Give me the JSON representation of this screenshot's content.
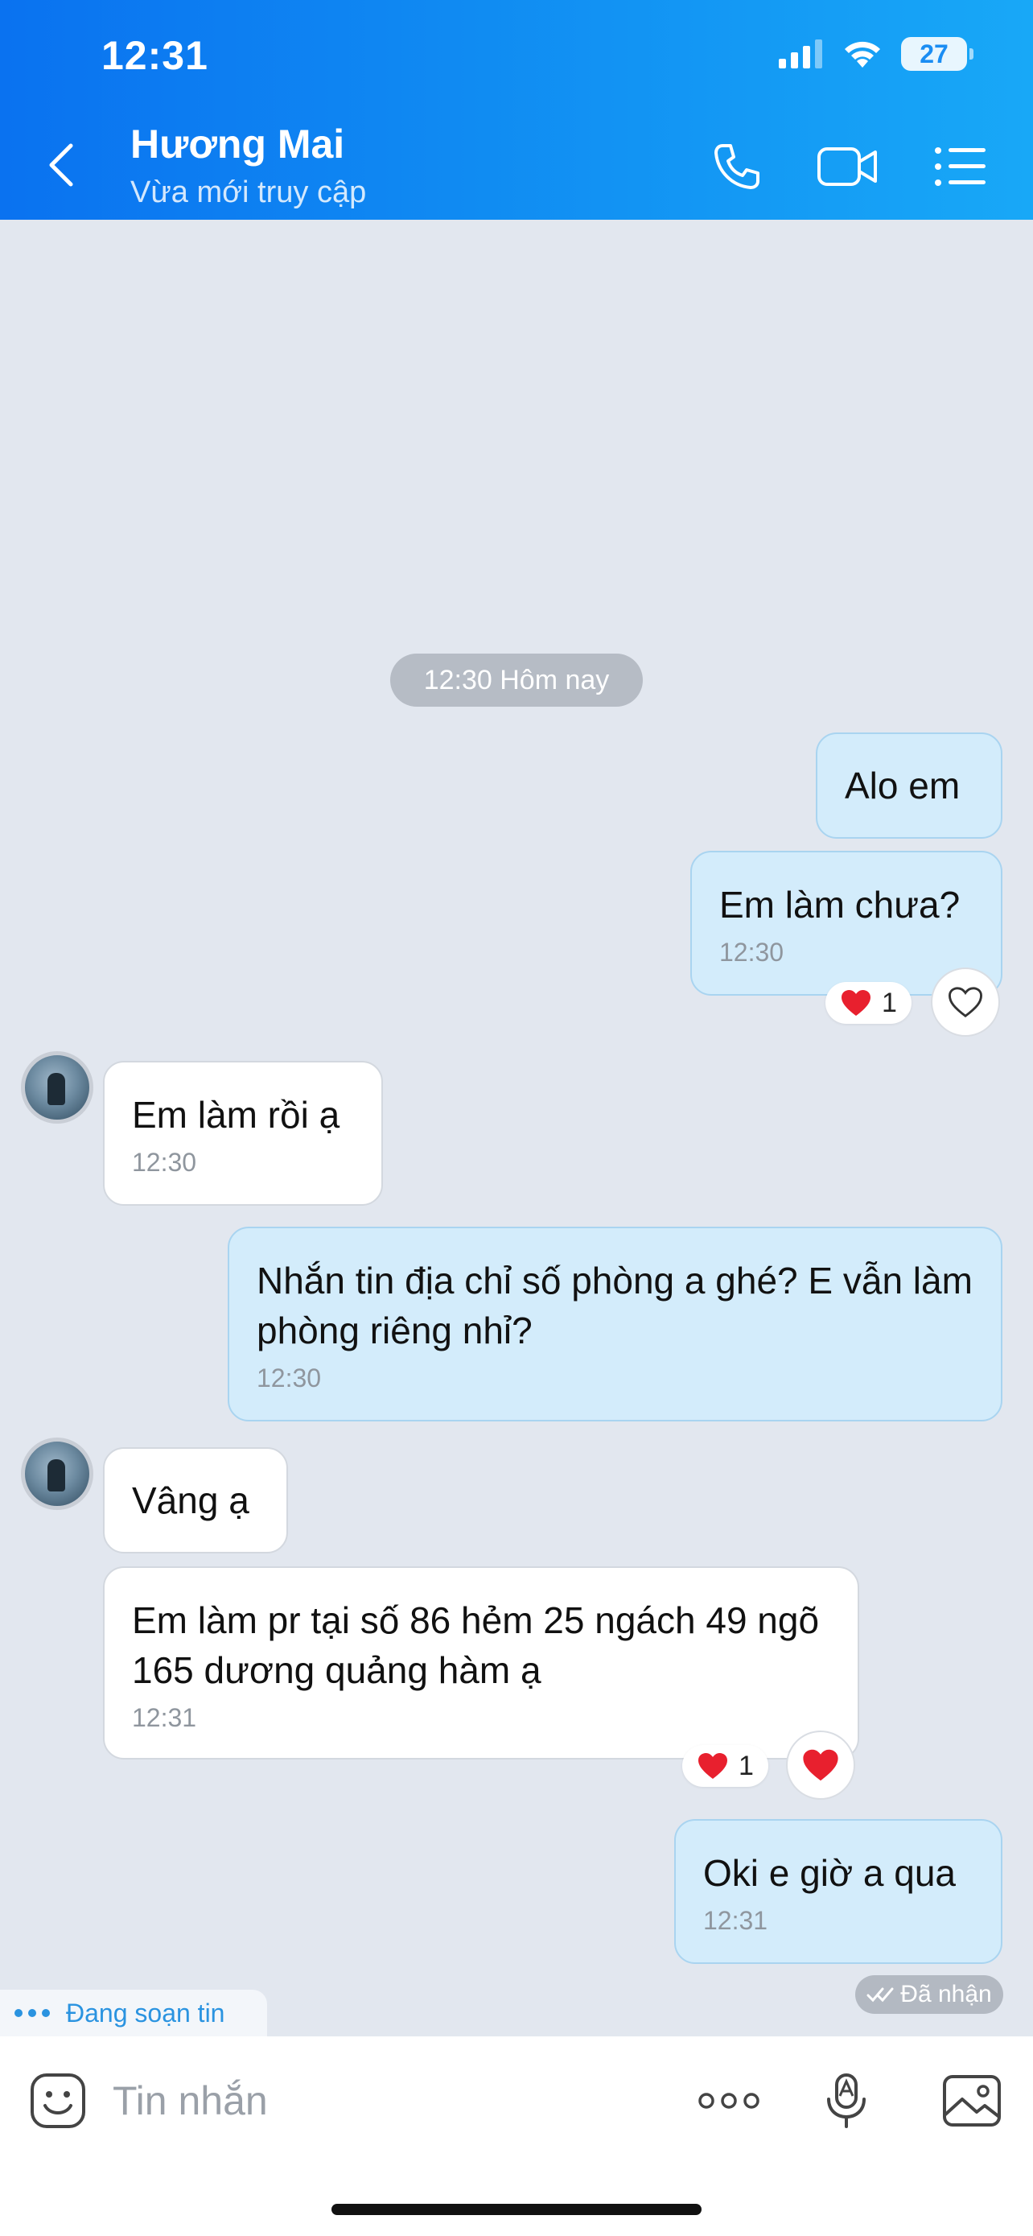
{
  "status_bar": {
    "time": "12:31",
    "battery": "27"
  },
  "header": {
    "name": "Hương Mai",
    "status": "Vừa mới truy cập"
  },
  "chat": {
    "date_label": "12:30 Hôm nay",
    "messages": [
      {
        "dir": "out",
        "text": "Alo em",
        "time": ""
      },
      {
        "dir": "out",
        "text": "Em làm chưa?",
        "time": "12:30",
        "reaction_count": "1"
      },
      {
        "dir": "in",
        "text": "Em làm rồi ạ",
        "time": "12:30"
      },
      {
        "dir": "out",
        "text": "Nhắn tin địa chỉ số phòng a ghé? E vẫn làm phòng riêng nhỉ?",
        "time": "12:30"
      },
      {
        "dir": "in",
        "text": "Vâng ạ",
        "time": ""
      },
      {
        "dir": "in",
        "text": "Em làm pr tại số 86 hẻm 25 ngách 49 ngõ 165 dương quảng hàm ạ",
        "time": "12:31",
        "reaction_count": "1"
      },
      {
        "dir": "out",
        "text": "Oki e giờ a qua",
        "time": "12:31"
      }
    ],
    "delivered_label": "Đã nhận",
    "typing_label": "Đang soạn tin"
  },
  "composer": {
    "placeholder": "Tin nhắn"
  },
  "colors": {
    "header_start": "#0a72f0",
    "header_end": "#18a8f7",
    "outgoing_bubble": "#d3ecfb",
    "incoming_bubble": "#ffffff",
    "chat_bg": "#e2e7ef",
    "heart": "#e8202e"
  }
}
